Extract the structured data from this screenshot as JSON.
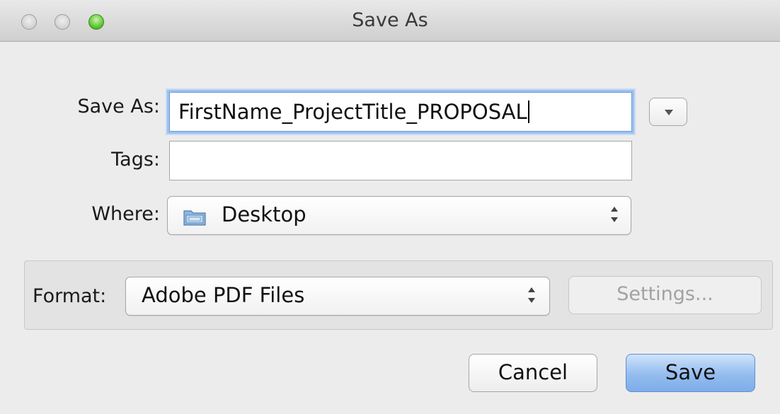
{
  "window": {
    "title": "Save As"
  },
  "form": {
    "save_as_label": "Save As:",
    "filename_value": "FirstName_ProjectTitle_PROPOSAL",
    "tags_label": "Tags:",
    "tags_value": "",
    "where_label": "Where:",
    "where_value": "Desktop",
    "format_label": "Format:",
    "format_value": "Adobe PDF Files"
  },
  "buttons": {
    "settings": "Settings...",
    "cancel": "Cancel",
    "save": "Save"
  },
  "icons": {
    "disclosure": "chevron-down-icon",
    "folder": "folder-icon"
  },
  "colors": {
    "focus_ring": "#9ec0ee",
    "default_button": "#93bcee",
    "zoom_button": "#4ebe25"
  }
}
